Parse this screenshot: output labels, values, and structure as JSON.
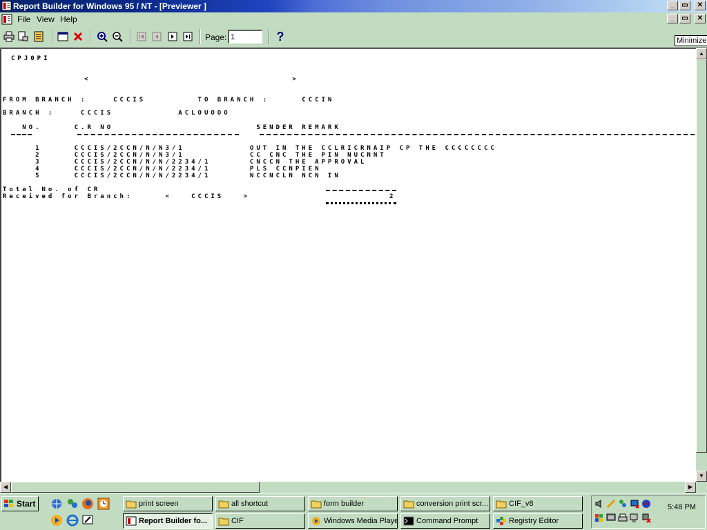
{
  "window": {
    "title": "Report Builder for Windows 95 / NT - [Previewer ]",
    "controls": {
      "minimize": "_",
      "maximize": "▭",
      "close": "✕"
    }
  },
  "menu": {
    "items": [
      "File",
      "View",
      "Help"
    ]
  },
  "toolbar": {
    "page_label": "Page:",
    "page_value": "1",
    "help": "?",
    "tooltip": "Minimize"
  },
  "report": {
    "lines": [
      "CPJ0PI",
      "<                               >",
      "FROM BRANCH :    CCCIS        TO BRANCH :     CCCIN",
      "BRANCH :    CCCIS          ACLOUOOO",
      "   NO.     C.R NO                      SENDER REMARK",
      "     1     CCCIS/2CCN/N/N3/1          OUT IN THE CCLRICRNAIP CP THE CCCCCCCC",
      "     2     CCCIS/2CCN/N/N3/1          CC CNC THE PIN NUCNNT",
      "     3     CCCIS/2CCN/N/N/2234/1      CNCCN THE APPROVAL",
      "     4     CCCIS/2CCN/N/N/2234/1      PLS CCNPIEN",
      "     5     CCCIS/2CCN/N/N/2234/1      NCCNCLN NCN IN",
      "Total No. of CR",
      "Received for Branch:     <   CCCIS   >",
      "2"
    ]
  },
  "taskbar": {
    "start": "Start",
    "tasks": [
      "print screen",
      "all shortcut",
      "form builder",
      "conversion print scr...",
      "CIF_v8",
      "Report Builder fo...",
      "CIF",
      "Windows Media Player",
      "Command Prompt",
      "Registry Editor"
    ],
    "clock": "5:48 PM"
  },
  "colors": {
    "title_dark": "#08246b",
    "title_light": "#c8e0f8",
    "chrome": "#c2dcc2"
  }
}
